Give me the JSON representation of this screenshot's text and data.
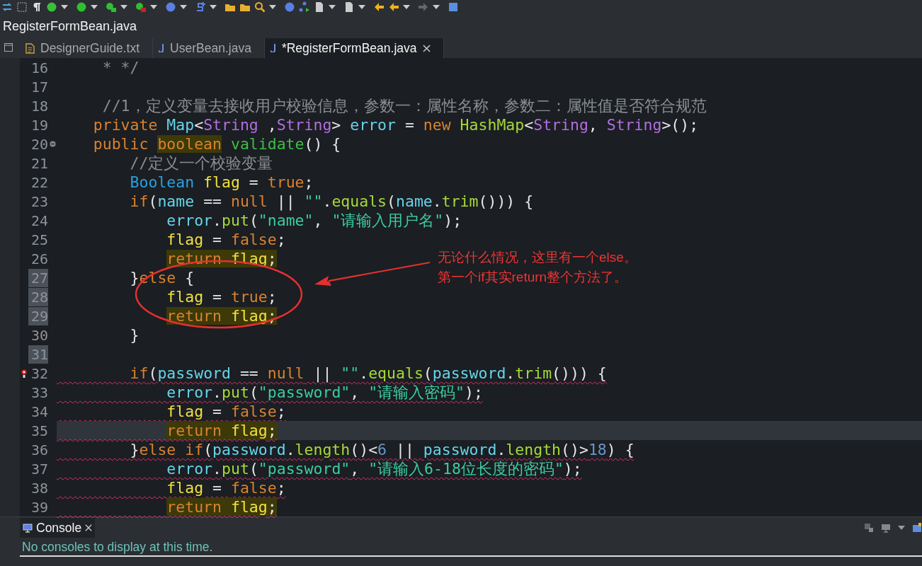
{
  "window": {
    "title": "RegisterFormBean.java"
  },
  "tabs": [
    {
      "label": "DesignerGuide.txt",
      "kind": "text",
      "selected": false
    },
    {
      "label": "UserBean.java",
      "kind": "java",
      "selected": false
    },
    {
      "label": "*RegisterFormBean.java",
      "kind": "java",
      "selected": true
    }
  ],
  "editor": {
    "lines": [
      {
        "number": "16",
        "current": false,
        "number_highlight": false,
        "fold": false,
        "error_marker": false,
        "underlined": false,
        "tokens": [
          {
            "text": "     * */",
            "kind": "comment"
          }
        ]
      },
      {
        "number": "17",
        "current": false,
        "number_highlight": false,
        "fold": false,
        "error_marker": false,
        "underlined": false
      },
      {
        "number": "18",
        "current": false,
        "number_highlight": false,
        "fold": false,
        "error_marker": false,
        "underlined": false,
        "tokens": [
          {
            "text": "     //1，定义变量去接收用户校验信息，参数一：属性名称，参数二：属性值是否符合规范",
            "kind": "comment"
          }
        ]
      },
      {
        "number": "19",
        "current": false,
        "number_highlight": false,
        "fold": false,
        "error_marker": false,
        "underlined": false,
        "tokens": [
          {
            "text": "    private",
            "kind": "keyword"
          },
          {
            "text": " Map",
            "kind": "field"
          },
          {
            "text": "<",
            "kind": "plain"
          },
          {
            "text": "String",
            "kind": "generic"
          },
          {
            "text": " ,",
            "kind": "plain"
          },
          {
            "text": "String",
            "kind": "generic"
          },
          {
            "text": ">",
            "kind": "plain"
          },
          {
            "text": " error",
            "kind": "field"
          },
          {
            "text": " = ",
            "kind": "plain"
          },
          {
            "text": "new",
            "kind": "keyword"
          },
          {
            "text": " HashMap",
            "kind": "call"
          },
          {
            "text": "<",
            "kind": "plain"
          },
          {
            "text": "String",
            "kind": "generic"
          },
          {
            "text": ", ",
            "kind": "plain"
          },
          {
            "text": "String",
            "kind": "generic"
          },
          {
            "text": ">();",
            "kind": "plain"
          }
        ]
      },
      {
        "number": "20",
        "current": false,
        "number_highlight": false,
        "fold": true,
        "error_marker": false,
        "underlined": false,
        "tokens": [
          {
            "text": "    public ",
            "kind": "keyword"
          },
          {
            "text": "boolean",
            "kind": "keyword-marked"
          },
          {
            "text": " validate",
            "kind": "method"
          },
          {
            "text": "() {",
            "kind": "plain"
          }
        ]
      },
      {
        "number": "21",
        "current": false,
        "number_highlight": false,
        "fold": false,
        "error_marker": false,
        "underlined": false,
        "tokens": [
          {
            "text": "        //定义一个校验变量",
            "kind": "comment"
          }
        ]
      },
      {
        "number": "22",
        "current": false,
        "number_highlight": false,
        "fold": false,
        "error_marker": false,
        "underlined": false,
        "tokens": [
          {
            "text": "        Boolean",
            "kind": "class"
          },
          {
            "text": " flag",
            "kind": "local"
          },
          {
            "text": " = ",
            "kind": "plain"
          },
          {
            "text": "true",
            "kind": "keyword"
          },
          {
            "text": ";",
            "kind": "plain"
          }
        ]
      },
      {
        "number": "23",
        "current": false,
        "number_highlight": false,
        "fold": false,
        "error_marker": false,
        "underlined": false,
        "tokens": [
          {
            "text": "        if",
            "kind": "keyword"
          },
          {
            "text": "(",
            "kind": "plain"
          },
          {
            "text": "name",
            "kind": "field"
          },
          {
            "text": " == ",
            "kind": "plain"
          },
          {
            "text": "null",
            "kind": "keyword"
          },
          {
            "text": " || ",
            "kind": "plain"
          },
          {
            "text": "\"\"",
            "kind": "string"
          },
          {
            "text": ".",
            "kind": "plain"
          },
          {
            "text": "equals",
            "kind": "call"
          },
          {
            "text": "(",
            "kind": "plain"
          },
          {
            "text": "name",
            "kind": "field"
          },
          {
            "text": ".",
            "kind": "plain"
          },
          {
            "text": "trim",
            "kind": "call"
          },
          {
            "text": "())) {",
            "kind": "plain"
          }
        ]
      },
      {
        "number": "24",
        "current": false,
        "number_highlight": false,
        "fold": false,
        "error_marker": false,
        "underlined": false,
        "tokens": [
          {
            "text": "            error",
            "kind": "field"
          },
          {
            "text": ".",
            "kind": "plain"
          },
          {
            "text": "put",
            "kind": "call"
          },
          {
            "text": "(",
            "kind": "plain"
          },
          {
            "text": "\"name\"",
            "kind": "string"
          },
          {
            "text": ", ",
            "kind": "plain"
          },
          {
            "text": "\"请输入用户名\"",
            "kind": "string"
          },
          {
            "text": ");",
            "kind": "plain"
          }
        ]
      },
      {
        "number": "25",
        "current": false,
        "number_highlight": false,
        "fold": false,
        "error_marker": false,
        "underlined": false,
        "tokens": [
          {
            "text": "            flag",
            "kind": "local"
          },
          {
            "text": " = ",
            "kind": "plain"
          },
          {
            "text": "false",
            "kind": "keyword"
          },
          {
            "text": ";",
            "kind": "plain"
          }
        ]
      },
      {
        "number": "26",
        "current": false,
        "number_highlight": false,
        "fold": false,
        "error_marker": false,
        "underlined": false,
        "tokens": [
          {
            "text": "            return ",
            "kind": "keyword-marked"
          },
          {
            "text": "flag",
            "kind": "local-marked"
          },
          {
            "text": ";",
            "kind": "plain-marked"
          }
        ]
      },
      {
        "number": "27",
        "current": false,
        "number_highlight": true,
        "fold": false,
        "error_marker": false,
        "underlined": false,
        "tokens": [
          {
            "text": "        }",
            "kind": "plain"
          },
          {
            "text": "else",
            "kind": "keyword"
          },
          {
            "text": " {",
            "kind": "plain"
          }
        ]
      },
      {
        "number": "28",
        "current": false,
        "number_highlight": true,
        "fold": false,
        "error_marker": false,
        "underlined": false,
        "tokens": [
          {
            "text": "            flag",
            "kind": "local"
          },
          {
            "text": " = ",
            "kind": "plain"
          },
          {
            "text": "true",
            "kind": "keyword"
          },
          {
            "text": ";",
            "kind": "plain"
          }
        ]
      },
      {
        "number": "29",
        "current": false,
        "number_highlight": true,
        "fold": false,
        "error_marker": false,
        "underlined": false,
        "tokens": [
          {
            "text": "            return ",
            "kind": "keyword-marked"
          },
          {
            "text": "flag",
            "kind": "local-marked"
          },
          {
            "text": ";",
            "kind": "plain-marked"
          }
        ]
      },
      {
        "number": "30",
        "current": false,
        "number_highlight": false,
        "fold": false,
        "error_marker": false,
        "underlined": false,
        "tokens": [
          {
            "text": "        }",
            "kind": "plain"
          }
        ]
      },
      {
        "number": "31",
        "current": false,
        "number_highlight": true,
        "fold": false,
        "error_marker": false,
        "underlined": false
      },
      {
        "number": "32",
        "current": false,
        "number_highlight": false,
        "fold": false,
        "error_marker": true,
        "underlined": true,
        "tokens": [
          {
            "text": "        if",
            "kind": "keyword"
          },
          {
            "text": "(",
            "kind": "plain"
          },
          {
            "text": "password",
            "kind": "field"
          },
          {
            "text": " == ",
            "kind": "plain"
          },
          {
            "text": "null",
            "kind": "keyword"
          },
          {
            "text": " || ",
            "kind": "plain"
          },
          {
            "text": "\"\"",
            "kind": "string"
          },
          {
            "text": ".",
            "kind": "plain"
          },
          {
            "text": "equals",
            "kind": "call"
          },
          {
            "text": "(",
            "kind": "plain"
          },
          {
            "text": "password",
            "kind": "field"
          },
          {
            "text": ".",
            "kind": "plain"
          },
          {
            "text": "trim",
            "kind": "call"
          },
          {
            "text": "())) {",
            "kind": "plain"
          }
        ]
      },
      {
        "number": "33",
        "current": false,
        "number_highlight": false,
        "fold": false,
        "error_marker": false,
        "underlined": true,
        "tokens": [
          {
            "text": "            error",
            "kind": "field"
          },
          {
            "text": ".",
            "kind": "plain"
          },
          {
            "text": "put",
            "kind": "call"
          },
          {
            "text": "(",
            "kind": "plain"
          },
          {
            "text": "\"password\"",
            "kind": "string"
          },
          {
            "text": ", ",
            "kind": "plain"
          },
          {
            "text": "\"请输入密码\"",
            "kind": "string"
          },
          {
            "text": ");",
            "kind": "plain"
          }
        ]
      },
      {
        "number": "34",
        "current": false,
        "number_highlight": false,
        "fold": false,
        "error_marker": false,
        "underlined": true,
        "tokens": [
          {
            "text": "            flag",
            "kind": "local"
          },
          {
            "text": " = ",
            "kind": "plain"
          },
          {
            "text": "false",
            "kind": "keyword"
          },
          {
            "text": ";",
            "kind": "plain"
          }
        ]
      },
      {
        "number": "35",
        "current": true,
        "number_highlight": false,
        "fold": false,
        "error_marker": false,
        "underlined": true,
        "tokens": [
          {
            "text": "            return ",
            "kind": "keyword-marked"
          },
          {
            "text": "flag",
            "kind": "local-marked"
          },
          {
            "text": ";",
            "kind": "plain-marked"
          }
        ]
      },
      {
        "number": "36",
        "current": false,
        "number_highlight": false,
        "fold": false,
        "error_marker": false,
        "underlined": true,
        "tokens": [
          {
            "text": "        }",
            "kind": "plain"
          },
          {
            "text": "else if",
            "kind": "keyword"
          },
          {
            "text": "(",
            "kind": "plain"
          },
          {
            "text": "password",
            "kind": "field"
          },
          {
            "text": ".",
            "kind": "plain"
          },
          {
            "text": "length",
            "kind": "call"
          },
          {
            "text": "()<",
            "kind": "plain"
          },
          {
            "text": "6",
            "kind": "number"
          },
          {
            "text": " || ",
            "kind": "plain"
          },
          {
            "text": "password",
            "kind": "field"
          },
          {
            "text": ".",
            "kind": "plain"
          },
          {
            "text": "length",
            "kind": "call"
          },
          {
            "text": "()>",
            "kind": "plain"
          },
          {
            "text": "18",
            "kind": "number"
          },
          {
            "text": ") {",
            "kind": "plain"
          }
        ]
      },
      {
        "number": "37",
        "current": false,
        "number_highlight": false,
        "fold": false,
        "error_marker": false,
        "underlined": true,
        "tokens": [
          {
            "text": "            error",
            "kind": "field"
          },
          {
            "text": ".",
            "kind": "plain"
          },
          {
            "text": "put",
            "kind": "call"
          },
          {
            "text": "(",
            "kind": "plain"
          },
          {
            "text": "\"password\"",
            "kind": "string"
          },
          {
            "text": ", ",
            "kind": "plain"
          },
          {
            "text": "\"请输入6-18位长度的密码\"",
            "kind": "string"
          },
          {
            "text": ");",
            "kind": "plain"
          }
        ]
      },
      {
        "number": "38",
        "current": false,
        "number_highlight": false,
        "fold": false,
        "error_marker": false,
        "underlined": true,
        "tokens": [
          {
            "text": "            flag",
            "kind": "local"
          },
          {
            "text": " = ",
            "kind": "plain"
          },
          {
            "text": "false",
            "kind": "keyword"
          },
          {
            "text": ";",
            "kind": "plain"
          }
        ]
      },
      {
        "number": "39",
        "current": false,
        "number_highlight": false,
        "fold": false,
        "error_marker": false,
        "underlined": true,
        "tokens": [
          {
            "text": "            return ",
            "kind": "keyword-marked"
          },
          {
            "text": "flag",
            "kind": "local-marked"
          },
          {
            "text": ";",
            "kind": "plain-marked"
          }
        ]
      }
    ],
    "annotation": {
      "lines": [
        "无论什么情况，这里有一个else。",
        "第一个if其实return整个方法了。"
      ]
    }
  },
  "console": {
    "tab": {
      "label": "Console",
      "selected": true
    },
    "message": "No consoles to display at this time."
  }
}
